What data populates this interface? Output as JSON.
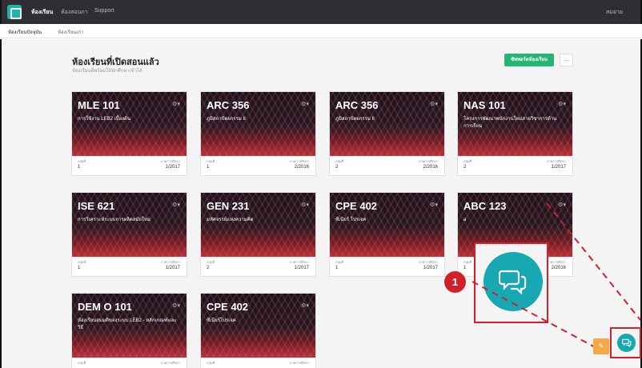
{
  "topbar": {
    "nav": [
      "ห้องเรียน",
      "ห้องสอบภา",
      "Support"
    ],
    "user": "สมยาย"
  },
  "subnav": {
    "tabs": [
      "ห้องเรียนปัจจุบัน",
      "ห้องเรียนเก่า"
    ]
  },
  "main": {
    "title": "ห้องเรียนที่เปิดสอนแล้ว",
    "subtitle": "ห้องเรียนที่พร้อมให้นักศึกษาเข้าได้",
    "support_button": "ซัพพอร์ตห้องเรียน",
    "more_button": "...",
    "labels": {
      "group": "กลุ่มที่",
      "term": "ภาคการศึกษา"
    },
    "courses": [
      {
        "code": "MLE 101",
        "name": "การใช้งาน LEB2 เบื้องต้น",
        "group": "1",
        "term": "1/2017"
      },
      {
        "code": "ARC 356",
        "name": "ภูมิสถาปัตยกรรม II",
        "group": "1",
        "term": "2/2016"
      },
      {
        "code": "ARC 356",
        "name": "ภูมิสถาปัตยกรรม II",
        "group": "2",
        "term": "2/2016"
      },
      {
        "code": "NAS 101",
        "name": "โครงการพัฒนาพนักงานใหม่สายวิชาการด้านการเรียน",
        "group": "2",
        "term": "1/2017"
      },
      {
        "code": "ISE 621",
        "name": "การวิเคราะห์ระบบการผลิตสมัยใหม่",
        "group": "1",
        "term": "1/2017"
      },
      {
        "code": "GEN 231",
        "name": "มหัศจรรย์แห่งความคิด",
        "group": "2",
        "term": "1/2017"
      },
      {
        "code": "CPE 402",
        "name": "ซีเนียร์ โปรเจค",
        "group": "1",
        "term": "1/2017"
      },
      {
        "code": "ABC 123",
        "name": "a",
        "group": "1",
        "term": "2/2016"
      },
      {
        "code": "DEM O 101",
        "name": "ห้องเรียนสมมติของระบบ LEB2 - หลักเกณฑ์และวิธี",
        "group": "",
        "term": ""
      },
      {
        "code": "CPE 402",
        "name": "ซีเนียร์โปรเจค",
        "group": "",
        "term": ""
      }
    ]
  },
  "callout": {
    "badge": "1"
  },
  "colors": {
    "accent": "#17a8b4",
    "support_button": "#22b573",
    "highlight": "#d0202a"
  }
}
